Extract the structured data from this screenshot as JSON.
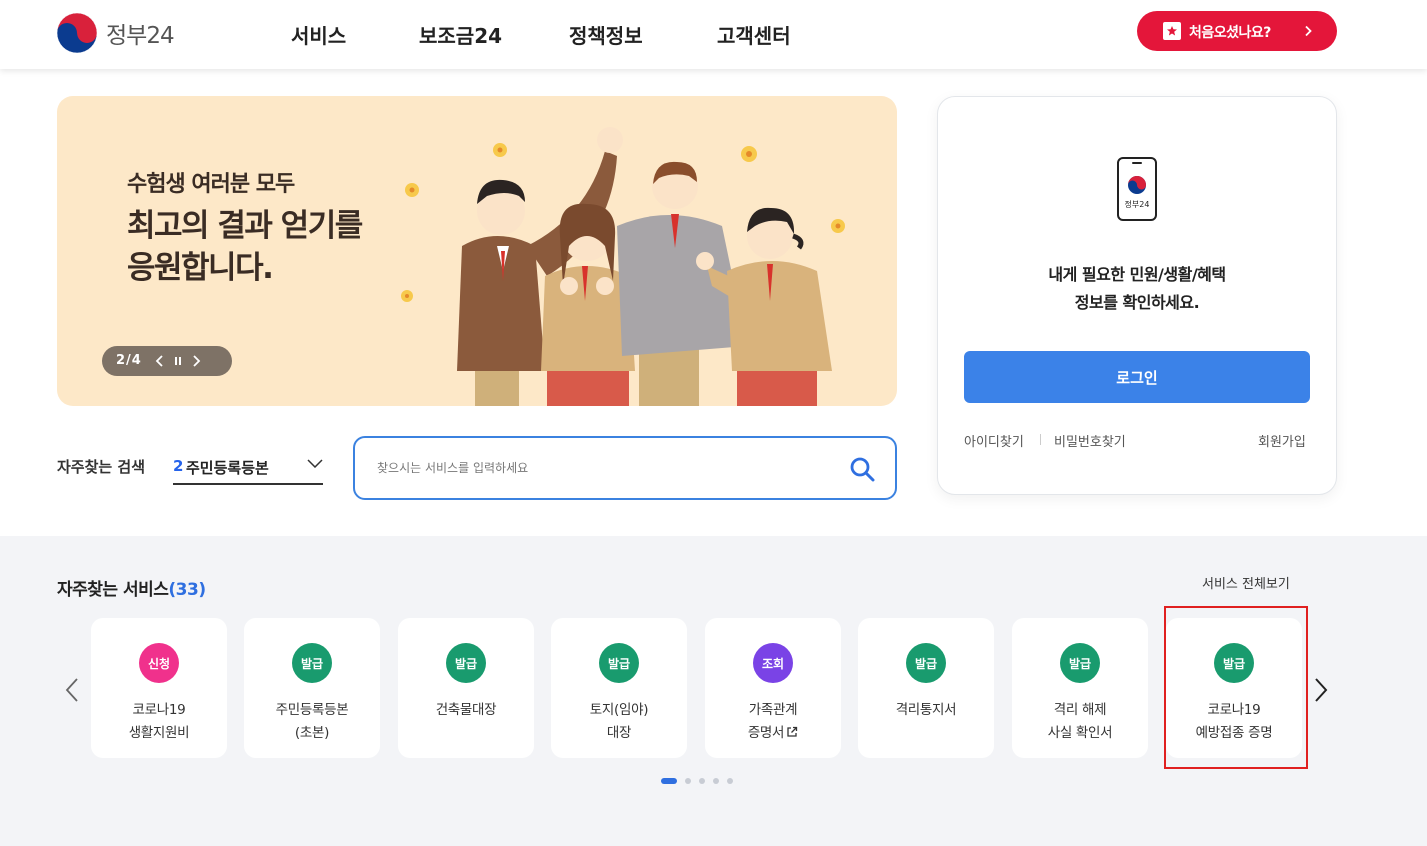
{
  "header": {
    "logo_text": "정부24",
    "nav": [
      "서비스",
      "보조금24",
      "정책정보",
      "고객센터"
    ],
    "cta_label": "처음오셨나요?"
  },
  "banner": {
    "line1": "수험생 여러분 모두",
    "line2": "최고의 결과 얻기를",
    "line3": "응원합니다.",
    "pager": "2/4",
    "current_slide": 2,
    "total_slides": 4
  },
  "search": {
    "favorite_label": "자주찾는 검색",
    "favorite_rank": "2",
    "favorite_value": "주민등록등본",
    "placeholder": "찾으시는 서비스를 입력하세요"
  },
  "login": {
    "phone_label": "정부24",
    "message_line1": "내게 필요한 민원/생활/혜택",
    "message_line2": "정보를 확인하세요.",
    "button": "로그인",
    "find_id": "아이디찾기",
    "find_pw": "비밀번호찾기",
    "signup": "회원가입"
  },
  "services": {
    "title": "자주찾는 서비스",
    "count_text": "(33)",
    "view_all": "서비스 전체보기",
    "items": [
      {
        "badge": "신청",
        "badge_color": "#f0318c",
        "line1": "코로나19",
        "line2": "생활지원비"
      },
      {
        "badge": "발급",
        "badge_color": "#199b6e",
        "line1": "주민등록등본",
        "line2": "(초본)"
      },
      {
        "badge": "발급",
        "badge_color": "#199b6e",
        "line1": "건축물대장",
        "line2": ""
      },
      {
        "badge": "발급",
        "badge_color": "#199b6e",
        "line1": "토지(임야)",
        "line2": "대장"
      },
      {
        "badge": "조회",
        "badge_color": "#7a43e6",
        "line1": "가족관계",
        "line2": "증명서"
      },
      {
        "badge": "발급",
        "badge_color": "#199b6e",
        "line1": "격리통지서",
        "line2": ""
      },
      {
        "badge": "발급",
        "badge_color": "#199b6e",
        "line1": "격리 해제",
        "line2": "사실 확인서"
      },
      {
        "badge": "발급",
        "badge_color": "#199b6e",
        "line1": "코로나19",
        "line2": "예방접종 증명"
      }
    ],
    "page_dots": 5,
    "active_dot": 1
  }
}
